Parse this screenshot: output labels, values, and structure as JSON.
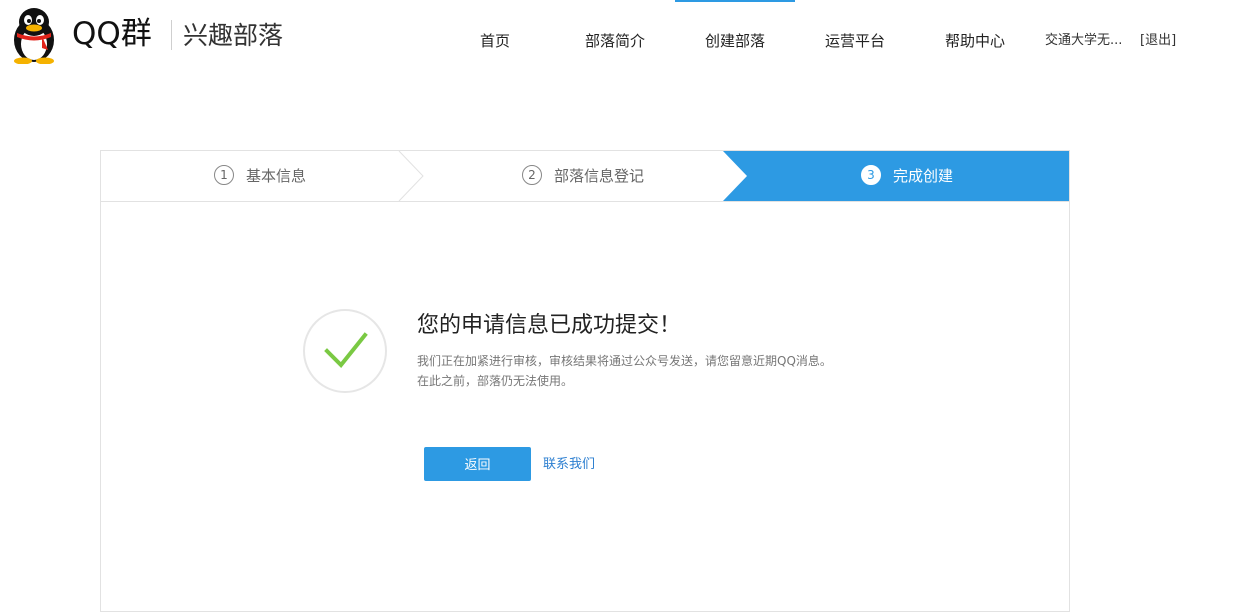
{
  "header": {
    "brand": "QQ群",
    "subtitle": "兴趣部落",
    "nav": [
      {
        "label": "首页",
        "active": false
      },
      {
        "label": "部落简介",
        "active": false
      },
      {
        "label": "创建部落",
        "active": true
      },
      {
        "label": "运营平台",
        "active": false
      },
      {
        "label": "帮助中心",
        "active": false
      }
    ],
    "user": "交通大学无...",
    "logout": "[退出]"
  },
  "steps": [
    {
      "num": "1",
      "label": "基本信息",
      "active": false
    },
    {
      "num": "2",
      "label": "部落信息登记",
      "active": false
    },
    {
      "num": "3",
      "label": "完成创建",
      "active": true
    }
  ],
  "result": {
    "title": "您的申请信息已成功提交！",
    "line1": "我们正在加紧进行审核，审核结果将通过公众号发送，请您留意近期QQ消息。",
    "line2": "在此之前，部落仍无法使用。",
    "back_label": "返回",
    "contact_label": "联系我们"
  },
  "colors": {
    "accent": "#2d9ae3",
    "check": "#7ac943",
    "link": "#2d7fd0"
  }
}
